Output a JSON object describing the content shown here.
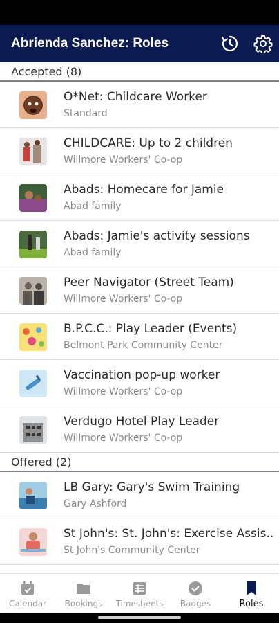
{
  "header": {
    "title": "Abrienda Sanchez: Roles"
  },
  "accepted": {
    "label": "Accepted (8)",
    "items": [
      {
        "title": "O*Net: Childcare Worker",
        "subtitle": "Standard"
      },
      {
        "title": "CHILDCARE: Up to 2 children",
        "subtitle": "Willmore Workers' Co-op"
      },
      {
        "title": "Abads: Homecare for Jamie",
        "subtitle": "Abad family"
      },
      {
        "title": "Abads: Jamie's activity sessions",
        "subtitle": "Abad family"
      },
      {
        "title": "Peer Navigator (Street Team)",
        "subtitle": "Willmore Workers' Co-op"
      },
      {
        "title": "B.P.C.C.: Play Leader (Events)",
        "subtitle": "Belmont Park Community Center"
      },
      {
        "title": "Vaccination pop-up worker",
        "subtitle": "Willmore Workers' Co-op"
      },
      {
        "title": "Verdugo Hotel Play Leader",
        "subtitle": "Willmore Workers' Co-op"
      }
    ]
  },
  "offered": {
    "label": "Offered (2)",
    "items": [
      {
        "title": "LB Gary: Gary's Swim Training",
        "subtitle": "Gary Ashford"
      },
      {
        "title": "St John's: St. John's: Exercise Assis...",
        "subtitle": "St John's Community Center"
      }
    ]
  },
  "nav": {
    "calendar": "Calendar",
    "bookings": "Bookings",
    "timesheets": "Timesheets",
    "badges": "Badges",
    "roles": "Roles"
  },
  "colors": {
    "appbar": "#0c1a52",
    "nav_inactive": "#9a9a9a",
    "nav_active": "#111111"
  }
}
